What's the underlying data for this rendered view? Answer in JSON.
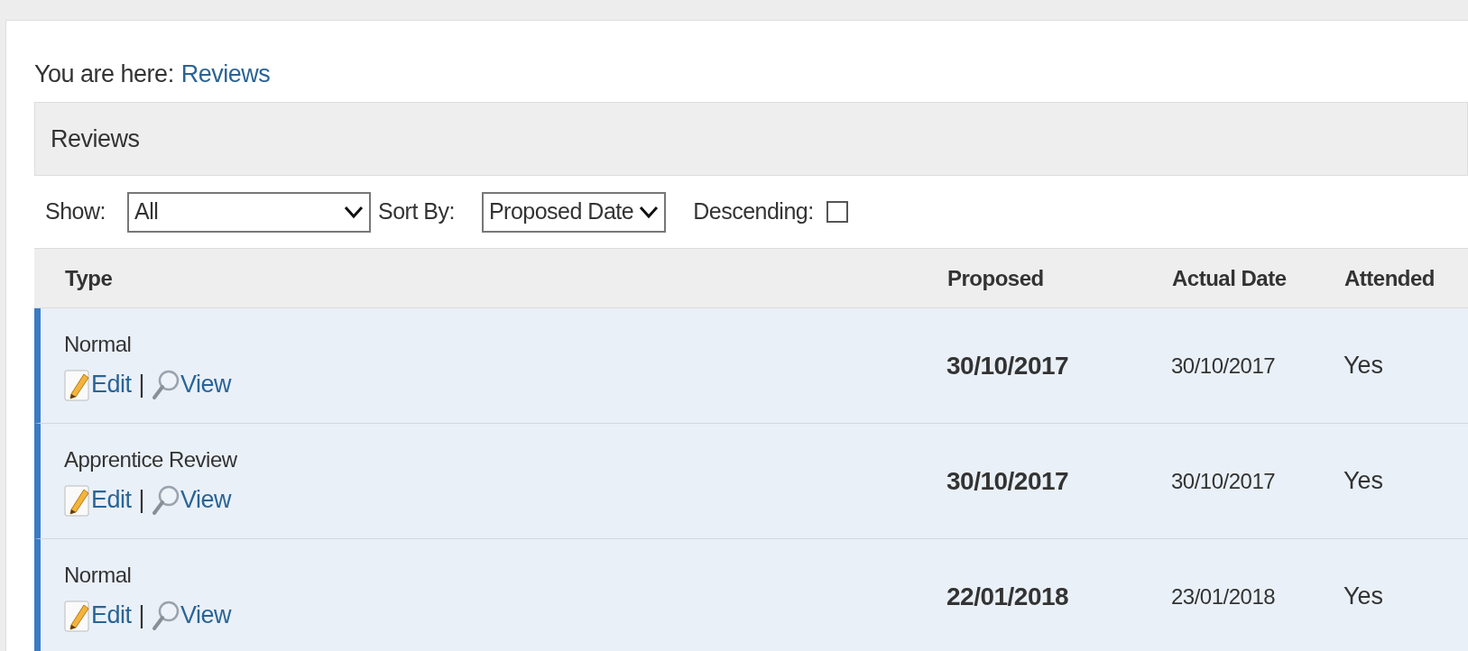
{
  "breadcrumb": {
    "label": "You are here:",
    "link": "Reviews"
  },
  "panel": {
    "title": "Reviews"
  },
  "filters": {
    "show_label": "Show:",
    "show_value": "All",
    "sort_label": "Sort By:",
    "sort_value": "Proposed Date",
    "descending_label": "Descending:",
    "descending_checked": false
  },
  "table": {
    "columns": [
      "Type",
      "Proposed",
      "Actual Date",
      "Attended"
    ],
    "rows": [
      {
        "type": "Normal",
        "edit": "Edit",
        "separator": "|",
        "view": "View",
        "proposed": "30/10/2017",
        "actual": "30/10/2017",
        "attended": "Yes"
      },
      {
        "type": "Apprentice Review",
        "edit": "Edit",
        "separator": "|",
        "view": "View",
        "proposed": "30/10/2017",
        "actual": "30/10/2017",
        "attended": "Yes"
      },
      {
        "type": "Normal",
        "edit": "Edit",
        "separator": "|",
        "view": "View",
        "proposed": "22/01/2018",
        "actual": "23/01/2018",
        "attended": "Yes"
      }
    ]
  }
}
